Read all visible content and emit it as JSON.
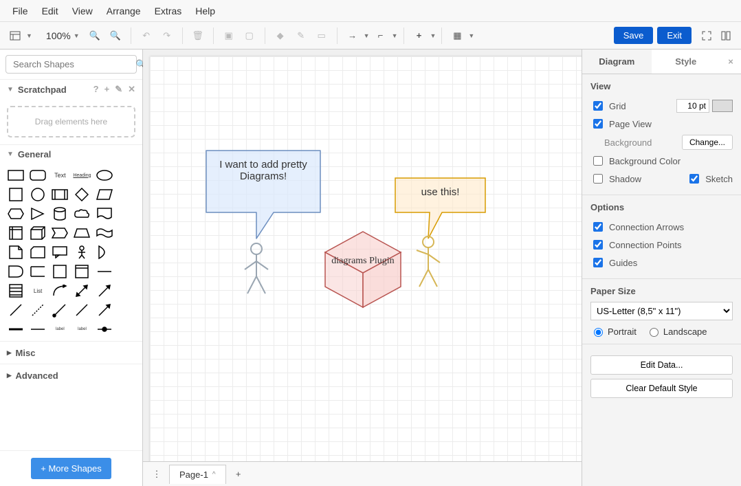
{
  "menubar": [
    "File",
    "Edit",
    "View",
    "Arrange",
    "Extras",
    "Help"
  ],
  "toolbar": {
    "zoom": "100%",
    "save": "Save",
    "exit": "Exit"
  },
  "search": {
    "placeholder": "Search Shapes"
  },
  "scratchpad": {
    "title": "Scratchpad",
    "drag_hint": "Drag elements here"
  },
  "general": {
    "title": "General"
  },
  "misc": {
    "title": "Misc"
  },
  "advanced": {
    "title": "Advanced"
  },
  "more_shapes": "+ More Shapes",
  "canvas": {
    "callout_blue": "I want to add pretty Diagrams!",
    "callout_orange": "use this!",
    "cube_label": "diagrams Plugin"
  },
  "page_tab": "Page-1",
  "right": {
    "tab_diagram": "Diagram",
    "tab_style": "Style",
    "view": {
      "title": "View",
      "grid": "Grid",
      "grid_size": "10 pt",
      "page_view": "Page View",
      "background": "Background",
      "change": "Change...",
      "background_color": "Background Color",
      "shadow": "Shadow",
      "sketch": "Sketch"
    },
    "options": {
      "title": "Options",
      "conn_arrows": "Connection Arrows",
      "conn_points": "Connection Points",
      "guides": "Guides"
    },
    "paper": {
      "title": "Paper Size",
      "selected": "US-Letter (8,5\" x 11\")",
      "portrait": "Portrait",
      "landscape": "Landscape"
    },
    "edit_data": "Edit Data...",
    "clear_style": "Clear Default Style"
  }
}
